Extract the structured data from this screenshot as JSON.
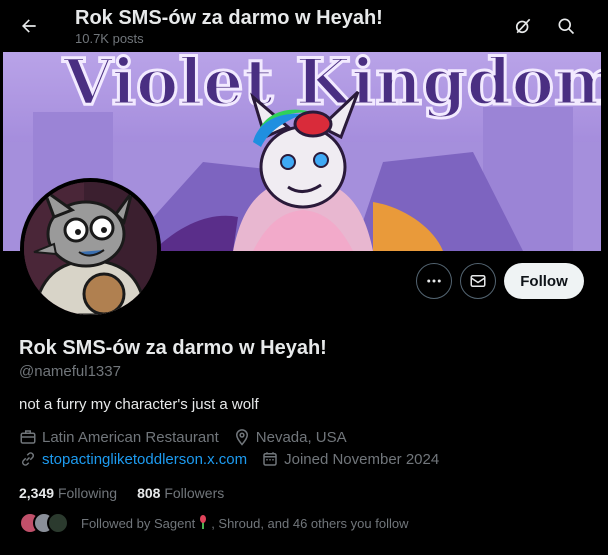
{
  "header": {
    "title": "Rok SMS-ów za darmo w Heyah!",
    "posts_count": "10.7K posts"
  },
  "banner": {
    "text": "Violet Kingdom"
  },
  "profile": {
    "display_name": "Rok SMS-ów za darmo w Heyah!",
    "handle": "@nameful1337",
    "bio": "not a furry my character's just a wolf",
    "category": "Latin American Restaurant",
    "location": "Nevada, USA",
    "website": "stopactingliketoddlerson.x.com",
    "joined": "Joined November 2024"
  },
  "actions": {
    "follow_label": "Follow"
  },
  "stats": {
    "following_count": "2,349",
    "following_label": "Following",
    "followers_count": "808",
    "followers_label": "Followers"
  },
  "followed_by": {
    "prefix": "Followed by Sagent",
    "suffix": ", Shroud, and 46 others you follow"
  },
  "colors": {
    "accent": "#1d9bf0",
    "muted": "#71767b",
    "text": "#e7e9ea",
    "background": "#000000"
  }
}
